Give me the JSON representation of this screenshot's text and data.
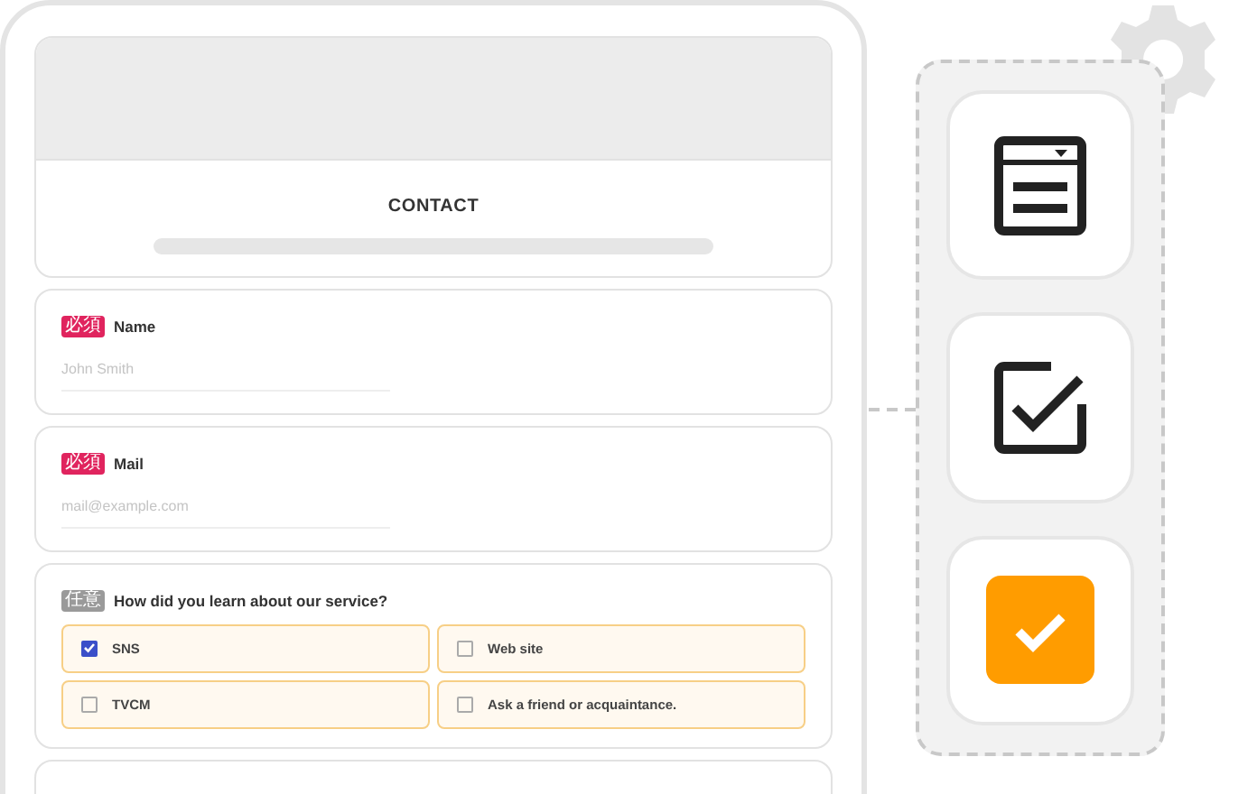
{
  "form": {
    "title": "CONTACT",
    "fields": [
      {
        "kind": "text",
        "badge": "必須",
        "required": true,
        "label": "Name",
        "placeholder": "John Smith"
      },
      {
        "kind": "text",
        "badge": "必須",
        "required": true,
        "label": "Mail",
        "placeholder": "mail@example.com"
      },
      {
        "kind": "checkboxes",
        "badge": "任意",
        "required": false,
        "label": "How did you learn about our service?",
        "options": [
          {
            "label": "SNS",
            "checked": true
          },
          {
            "label": "Web site",
            "checked": false
          },
          {
            "label": "TVCM",
            "checked": false
          },
          {
            "label": "Ask a friend or acquaintance.",
            "checked": false
          }
        ]
      }
    ]
  },
  "tools": [
    {
      "kind": "form"
    },
    {
      "kind": "checkbox"
    },
    {
      "kind": "check-button"
    }
  ]
}
